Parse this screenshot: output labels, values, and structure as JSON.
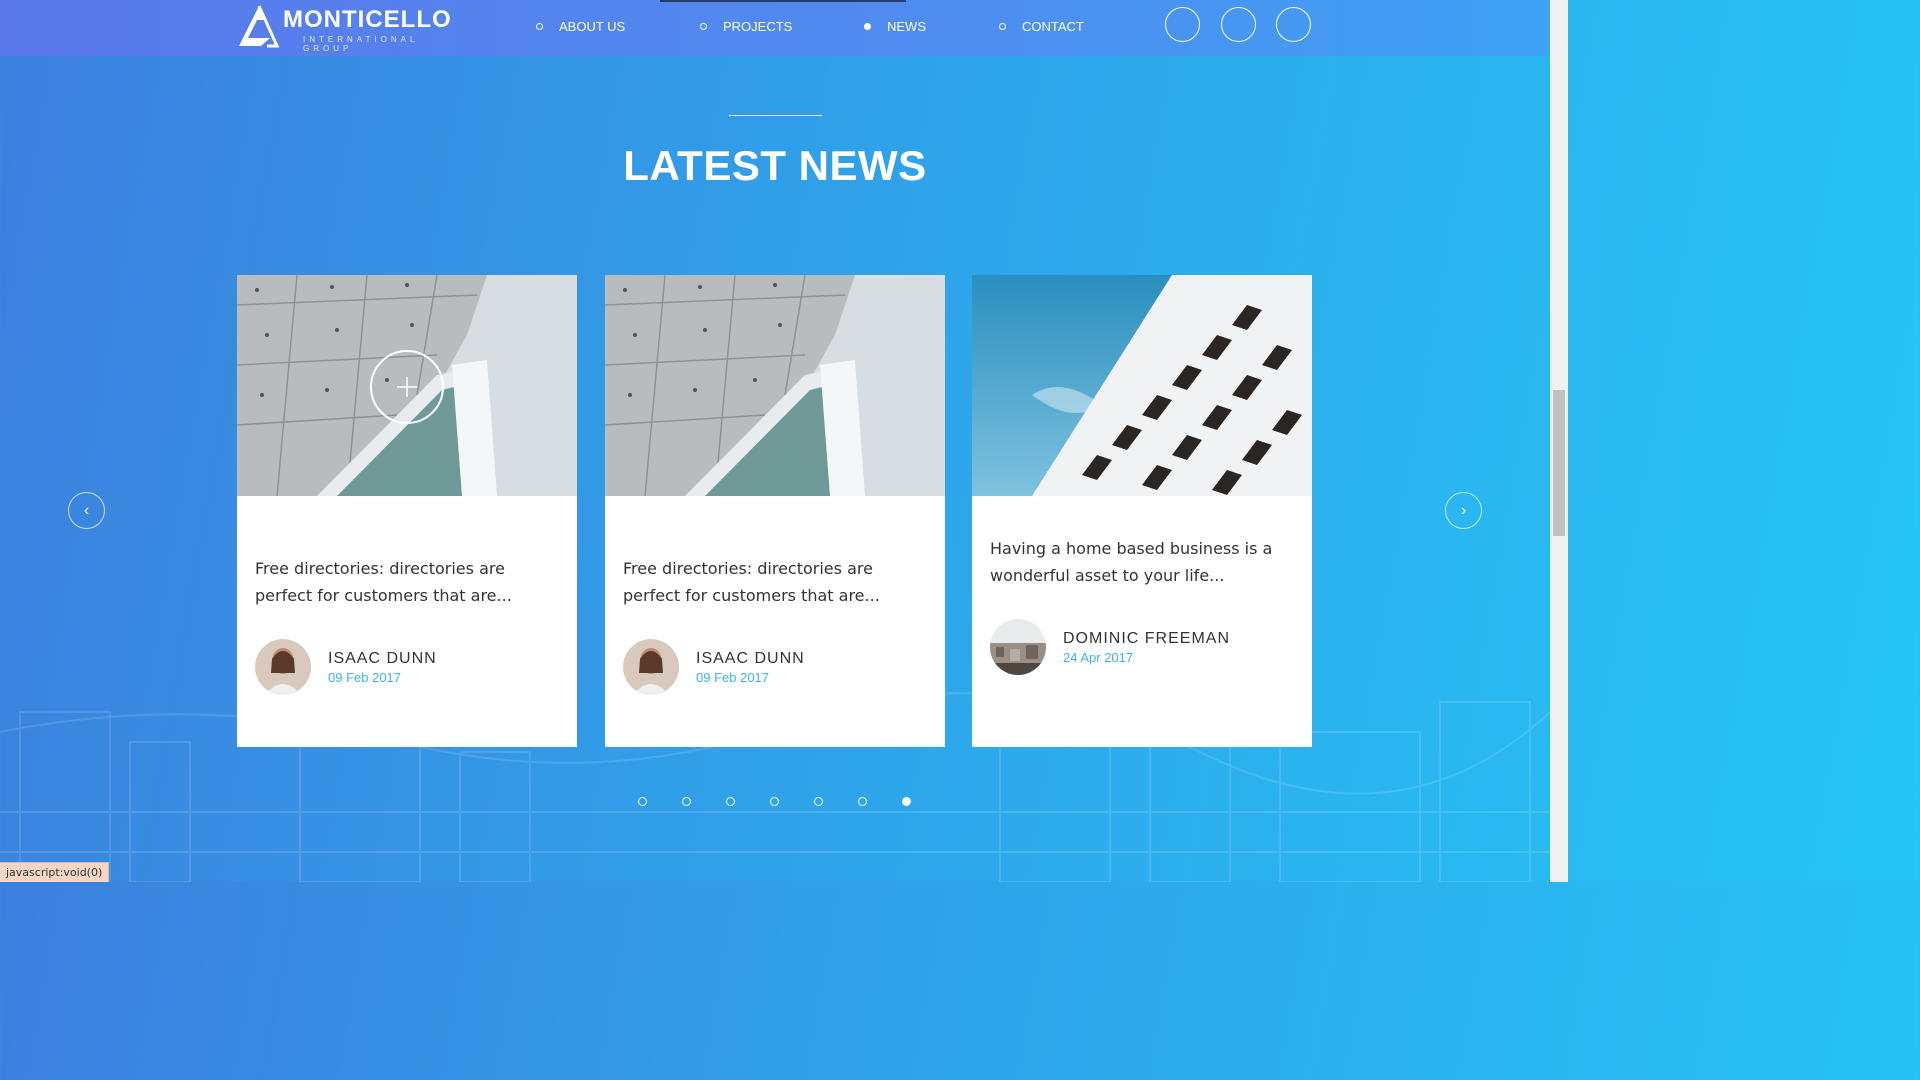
{
  "header": {
    "logo_name": "MONTICELLO",
    "logo_sub": "INTERNATIONAL GROUP",
    "nav": [
      {
        "label": "ABOUT US",
        "active": false
      },
      {
        "label": "PROJECTS",
        "active": false
      },
      {
        "label": "NEWS",
        "active": true
      },
      {
        "label": "CONTACT",
        "active": false
      }
    ],
    "social_icons": [
      "social-icon-1",
      "social-icon-2",
      "social-icon-3"
    ]
  },
  "section": {
    "title": "LATEST NEWS"
  },
  "cards": [
    {
      "image": "concrete-building-glass",
      "excerpt": "Free directories: directories are perfect for customers that are...",
      "author": "ISAAC DUNN",
      "date": "09 Feb 2017"
    },
    {
      "image": "concrete-building-glass",
      "excerpt": "Free directories: directories are perfect for customers that are...",
      "author": "ISAAC DUNN",
      "date": "09 Feb 2017"
    },
    {
      "image": "white-highrise-sky",
      "excerpt": "Having a home based business is a wonderful asset to your life...",
      "author": "DOMINIC FREEMAN",
      "date": "24 Apr 2017"
    }
  ],
  "carousel": {
    "prev_icon": "chevron-left-icon",
    "next_icon": "chevron-right-icon",
    "dot_count": 7,
    "active_dot": 7
  },
  "status_bar": "javascript:void(0)",
  "colors": {
    "accent_date": "#3bb3ea",
    "header_bg": "#4f8cf0"
  }
}
